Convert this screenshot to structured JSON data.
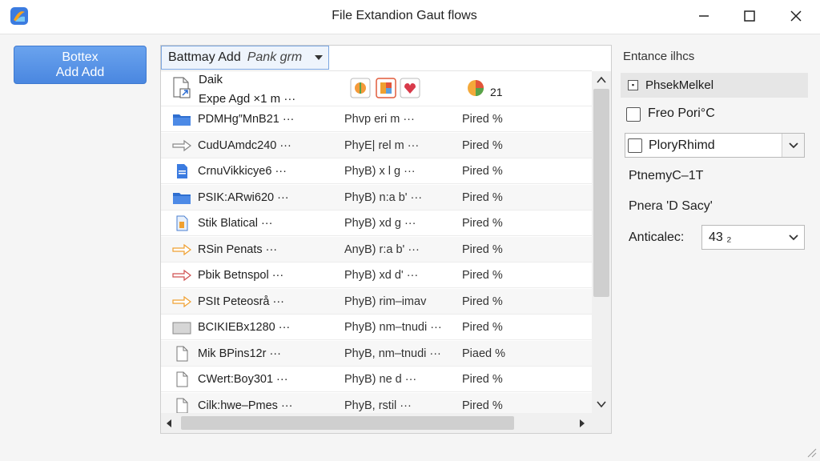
{
  "window": {
    "title": "File Extandion Gaut flows"
  },
  "sidebar": {
    "primary_button": {
      "line1": "Bottex",
      "line2": "Add Add"
    }
  },
  "list": {
    "dropdown_label": "Battmay Add",
    "dropdown_value": "Pank grm",
    "first_row": {
      "name_line1": "Daik",
      "name_line2": "Expe Agd ×1 m ···",
      "count": "21"
    },
    "rows": [
      {
        "name": "PDMHg″MnB21 ···",
        "type": "Phvp  eri  m ···",
        "status": "Pired %",
        "icon": "folder-icon"
      },
      {
        "name": "CudUAmdc240 ···",
        "type": "PhyE|  rel  m ···",
        "status": "Pired %",
        "icon": "arrow-icon"
      },
      {
        "name": "CrnuVikkicye6 ···",
        "type": "PhyB)  x l  g ···",
        "status": "Pired %",
        "icon": "document-icon"
      },
      {
        "name": "PSIK:ARwi620 ···",
        "type": "PhyB)  n:a  b' ···",
        "status": "Pired %",
        "icon": "folder-icon"
      },
      {
        "name": "Stik Blatical ···",
        "type": "PhyB)  xd  g ···",
        "status": "Pired %",
        "icon": "archive-icon"
      },
      {
        "name": "RSin Penats ···",
        "type": "AnyB)  r:a  b' ···",
        "status": "Pired %",
        "icon": "arrow-icon"
      },
      {
        "name": "Pbik Betnspol ···",
        "type": "PhyB)  xd  d' ···",
        "status": "Pired %",
        "icon": "arrow-icon"
      },
      {
        "name": "PSIt Peteosrå ···",
        "type": "PhyB)  rim–imav",
        "status": "Pired %",
        "icon": "arrow-icon"
      },
      {
        "name": "BCIKIEBx1280 ···",
        "type": "PhyB)  nm–tnudi ···",
        "status": "Pired %",
        "icon": "gray-file-icon"
      },
      {
        "name": "Mik BPins12r ···",
        "type": "PhyB,  nm–tnudi ···",
        "status": "Piaed %",
        "icon": "blank-file-icon"
      },
      {
        "name": "CWert:Boy301 ···",
        "type": "PhyB)  ne  d ···",
        "status": "Pired %",
        "icon": "blank-file-icon"
      },
      {
        "name": "Cilk:hwe–Pmes ···",
        "type": "PhyB,  rstil ···",
        "status": "Pired %",
        "icon": "blank-file-icon"
      }
    ]
  },
  "options_panel": {
    "heading": "Entance ilhcs",
    "selected_item": "PhsekMelkel",
    "checkbox1": "Freo Pori°C",
    "combo_value": "PloryRhimd",
    "text1": "PtnemyC–1T",
    "text2": "Pnera 'D Sacy'",
    "field_label": "Anticalec:",
    "field_value": "43 ₂"
  },
  "colors": {
    "accent": "#4a87e0",
    "window_bg": "#f5f5f5"
  }
}
